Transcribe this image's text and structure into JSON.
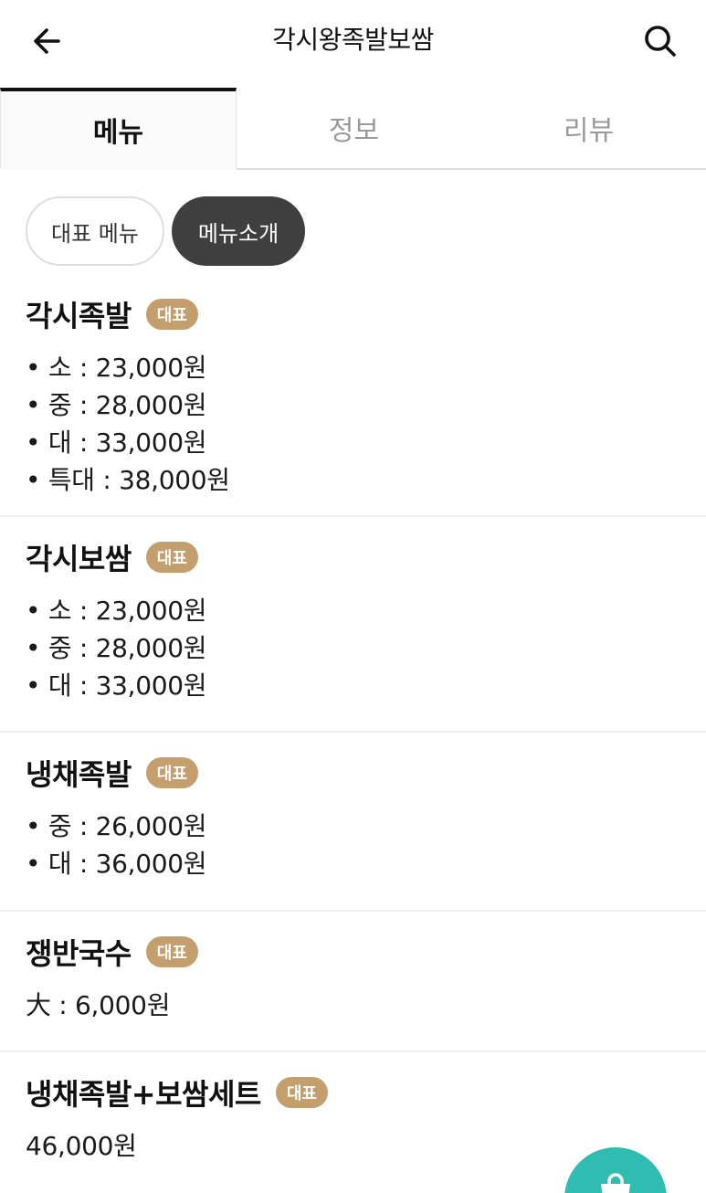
{
  "header": {
    "title": "각시왕족발보쌈",
    "back_icon": "arrow-left-icon",
    "search_icon": "search-icon"
  },
  "tabs": [
    {
      "label": "메뉴",
      "active": true
    },
    {
      "label": "정보",
      "active": false
    },
    {
      "label": "리뷰",
      "active": false
    }
  ],
  "chips": [
    {
      "label": "대표 메뉴",
      "selected": false
    },
    {
      "label": "메뉴소개",
      "selected": true
    }
  ],
  "menu": [
    {
      "name": "각시족발",
      "badge": "대표",
      "prices": [
        "• 소 : 23,000원",
        "• 중 : 28,000원",
        "• 대 : 33,000원",
        "• 특대 : 38,000원"
      ]
    },
    {
      "name": "각시보쌈",
      "badge": "대표",
      "prices": [
        "• 소 : 23,000원",
        "• 중 : 28,000원",
        "• 대 : 33,000원"
      ]
    },
    {
      "name": "냉채족발",
      "badge": "대표",
      "prices": [
        "• 중 : 26,000원",
        "• 대 : 36,000원"
      ]
    },
    {
      "name": "쟁반국수",
      "badge": "대표",
      "prices": [
        "大 : 6,000원"
      ]
    },
    {
      "name": "냉채족발+보쌈세트",
      "badge": "대표",
      "prices": [
        "46,000원"
      ]
    }
  ],
  "colors": {
    "badge": "#c49e6c",
    "chip_selected": "#3f3f3f",
    "fab": "#2fbdb2"
  },
  "fab": {
    "icon": "cart-icon"
  }
}
